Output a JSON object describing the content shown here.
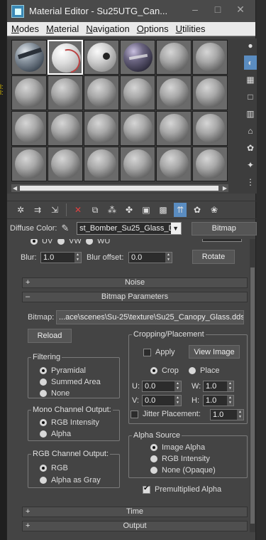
{
  "window": {
    "title": "Material Editor - Su25UTG_Can..."
  },
  "menu": [
    {
      "pre": "M",
      "post": "odes"
    },
    {
      "pre": "M",
      "post": "aterial"
    },
    {
      "pre": "N",
      "post": "avigation"
    },
    {
      "pre": "O",
      "post": "ptions"
    },
    {
      "pre": "U",
      "post": "tilities"
    }
  ],
  "toolbar": {
    "diffuse_label": "Diffuse Color:",
    "map_name": "st_Bomber_Su25_Glass_D",
    "map_type": "Bitmap"
  },
  "coords": {
    "uv": "UV",
    "vw": "VW",
    "wu": "WU",
    "blur_label": "Blur:",
    "blur": "1.0",
    "blur_offset_label": "Blur offset:",
    "blur_offset": "0.0",
    "rotate": "Rotate"
  },
  "rollouts": {
    "noise": "Noise",
    "bitmap_params": "Bitmap Parameters",
    "time": "Time",
    "output": "Output"
  },
  "bitmap": {
    "label": "Bitmap:",
    "path": "...ace\\scenes\\Su-25\\texture\\Su25_Canopy_Glass.dds",
    "reload": "Reload"
  },
  "filtering": {
    "title": "Filtering",
    "options": [
      "Pyramidal",
      "Summed Area",
      "None"
    ]
  },
  "mono": {
    "title": "Mono Channel Output:",
    "options": [
      "RGB Intensity",
      "Alpha"
    ]
  },
  "rgb": {
    "title": "RGB Channel Output:",
    "options": [
      "RGB",
      "Alpha as Gray"
    ]
  },
  "cropping": {
    "title": "Cropping/Placement",
    "apply": "Apply",
    "view_image": "View Image",
    "crop": "Crop",
    "place": "Place",
    "u_label": "U:",
    "u": "0.0",
    "v_label": "V:",
    "v": "0.0",
    "w_label": "W:",
    "w": "1.0",
    "h_label": "H:",
    "h": "1.0",
    "jitter_label": "Jitter Placement:",
    "jitter": "1.0"
  },
  "alpha": {
    "title": "Alpha Source",
    "options": [
      "Image Alpha",
      "RGB Intensity",
      "None (Opaque)"
    ]
  },
  "premult": "Premultiplied Alpha"
}
